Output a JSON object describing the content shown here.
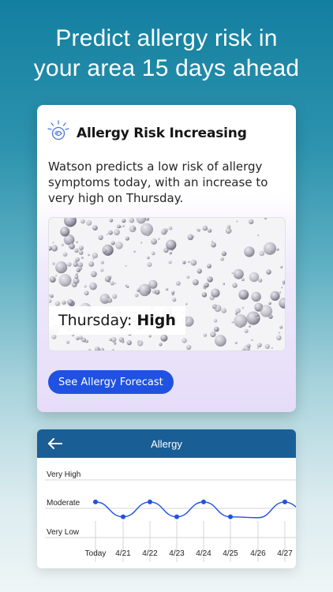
{
  "headline": {
    "line1": "Predict allergy risk in",
    "line2": "your area 15 days ahead"
  },
  "card": {
    "icon": "watson-bulb-icon",
    "title": "Allergy Risk Increasing",
    "body": "Watson predicts a low risk of allergy symptoms today, with an increase to very high on Thursday.",
    "day_label": "Thursday:",
    "day_level": "High",
    "cta_label": "See Allergy Forecast",
    "accent_color": "#1f52e0"
  },
  "panel": {
    "title": "Allergy",
    "back_icon": "arrow-left-icon",
    "bar_color": "#1a5e96"
  },
  "chart_data": {
    "type": "line",
    "title": "",
    "y_levels": [
      "Very Low",
      "Moderate",
      "Very High"
    ],
    "y_tick_labels": [
      "Very High",
      "Moderate",
      "Very Low"
    ],
    "categories": [
      "Today",
      "4/21",
      "4/22",
      "4/23",
      "4/24",
      "4/25",
      "4/26",
      "4/27"
    ],
    "series": [
      {
        "values": [
          1.15,
          0.8,
          1.15,
          0.8,
          1.15,
          0.8,
          0.78,
          1.15
        ],
        "color": "#1f52e0"
      }
    ],
    "ylim": [
      0,
      2
    ],
    "grid": true
  }
}
